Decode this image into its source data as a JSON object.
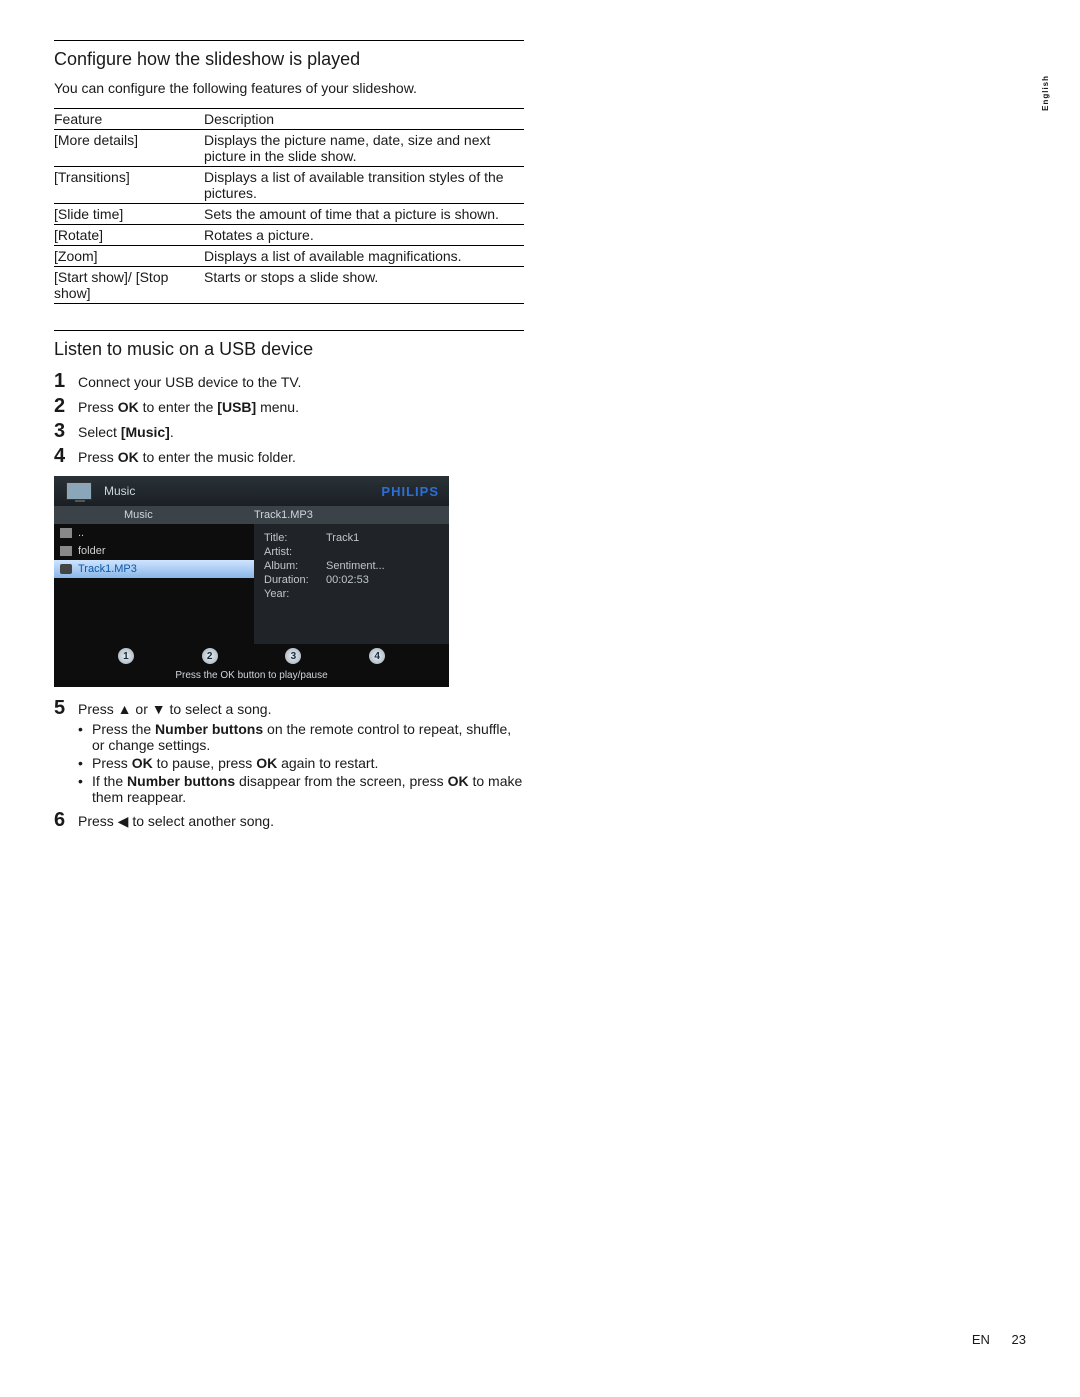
{
  "side_tab": "English",
  "section1": {
    "heading": "Configure how the slideshow is played",
    "intro": "You can configure the following features of your slideshow.",
    "table": {
      "head_feature": "Feature",
      "head_description": "Description",
      "rows": [
        {
          "feature": "[More details]",
          "desc": "Displays the picture name, date, size and next picture in the slide show."
        },
        {
          "feature": "[Transitions]",
          "desc": "Displays a list of available transition styles of the pictures."
        },
        {
          "feature": "[Slide time]",
          "desc": "Sets the amount of time that a picture is shown."
        },
        {
          "feature": "[Rotate]",
          "desc": "Rotates a picture."
        },
        {
          "feature": "[Zoom]",
          "desc": "Displays a list of available magnifications."
        },
        {
          "feature": "[Start show]/ [Stop show]",
          "desc": "Starts or stops a slide show."
        }
      ]
    }
  },
  "section2": {
    "heading": "Listen to music on a USB device",
    "steps": {
      "s1": "Connect your USB device to the TV.",
      "s2_a": "Press ",
      "s2_b": "OK",
      "s2_c": " to enter the ",
      "s2_d": "[USB]",
      "s2_e": " menu.",
      "s3_a": "Select ",
      "s3_b": "[Music]",
      "s3_c": ".",
      "s4_a": "Press ",
      "s4_b": "OK",
      "s4_c": " to enter the music folder.",
      "s5": "Press ▲ or ▼ to select a song.",
      "s5_bullets": {
        "b1_a": "Press the ",
        "b1_b": "Number buttons",
        "b1_c": " on the remote control to repeat, shuffle, or change settings.",
        "b2_a": "Press ",
        "b2_b": "OK",
        "b2_c": " to pause, press ",
        "b2_d": "OK",
        "b2_e": " again to restart.",
        "b3_a": "If the ",
        "b3_b": "Number buttons",
        "b3_c": " disappear from the screen, press ",
        "b3_d": "OK",
        "b3_e": " to make them reappear."
      },
      "s6": "Press ◀ to select another song."
    }
  },
  "music_ui": {
    "brand": "PHILIPS",
    "header_title": "Music",
    "crumb_left": "Music",
    "crumb_right": "Track1.MP3",
    "files": {
      "up": "..",
      "folder": "folder",
      "track": "Track1.MP3"
    },
    "meta": {
      "title_k": "Title:",
      "title_v": "Track1",
      "artist_k": "Artist:",
      "artist_v": "",
      "album_k": "Album:",
      "album_v": "Sentiment...",
      "duration_k": "Duration:",
      "duration_v": "00:02:53",
      "year_k": "Year:",
      "year_v": ""
    },
    "nums": [
      "1",
      "2",
      "3",
      "4"
    ],
    "hint": "Press the OK button to play/pause"
  },
  "footer": {
    "lang": "EN",
    "page": "23"
  }
}
